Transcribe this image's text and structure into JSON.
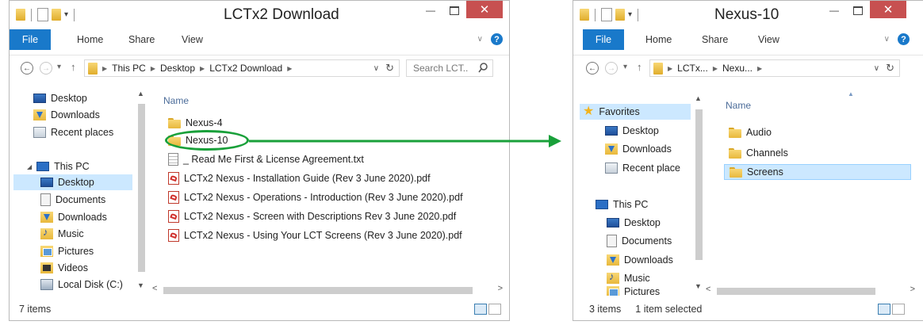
{
  "windows": [
    {
      "title": "LCTx2 Download",
      "ribbon": {
        "file": "File",
        "home": "Home",
        "share": "Share",
        "view": "View"
      },
      "breadcrumb": [
        "This PC",
        "Desktop",
        "LCTx2 Download"
      ],
      "search_placeholder": "Search LCT...",
      "nav": [
        "Desktop",
        "Downloads",
        "Recent places",
        "This PC",
        "Desktop",
        "Documents",
        "Downloads",
        "Music",
        "Pictures",
        "Videos",
        "Local Disk (C:)"
      ],
      "column_header": "Name",
      "files": [
        "Nexus-4",
        "Nexus-10",
        "_ Read Me First & License Agreement.txt",
        "LCTx2 Nexus - Installation Guide (Rev 3 June 2020).pdf",
        "LCTx2 Nexus - Operations - Introduction (Rev 3 June 2020).pdf",
        "LCTx2 Nexus - Screen with Descriptions Rev 3 June 2020.pdf",
        "LCTx2 Nexus - Using Your LCT Screens (Rev 3 June 2020).pdf"
      ],
      "status": "7 items"
    },
    {
      "title": "Nexus-10",
      "ribbon": {
        "file": "File",
        "home": "Home",
        "share": "Share",
        "view": "View"
      },
      "breadcrumb": [
        "LCTx...",
        "Nexu..."
      ],
      "nav": [
        "Favorites",
        "Desktop",
        "Downloads",
        "Recent place",
        "This PC",
        "Desktop",
        "Documents",
        "Downloads",
        "Music",
        "Pictures"
      ],
      "column_header": "Name",
      "files": [
        "Audio",
        "Channels",
        "Screens"
      ],
      "status_items": "3 items",
      "status_selected": "1 item selected"
    }
  ],
  "colors": {
    "accent": "#1979ca",
    "close": "#c75050",
    "selection": "#cce8ff",
    "highlight": "#19a03a"
  }
}
